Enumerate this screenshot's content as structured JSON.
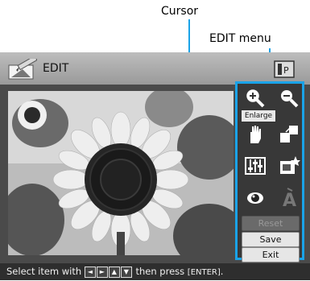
{
  "callouts": {
    "cursor": "Cursor",
    "edit_menu": "EDIT menu"
  },
  "header": {
    "title": "EDIT",
    "edit_icon": "pencil-edit-icon",
    "printer_icon": "print-mode-icon"
  },
  "photo": {
    "subject": "sunflower"
  },
  "menu": {
    "tooltip": "Enlarge",
    "tools": [
      {
        "name": "enlarge-icon"
      },
      {
        "name": "reduce-icon"
      },
      {
        "name": "move-hand-icon"
      },
      {
        "name": "rotate-icon"
      },
      {
        "name": "adjust-icon"
      },
      {
        "name": "filter-icon"
      },
      {
        "name": "red-eye-icon"
      },
      {
        "name": "text-icon"
      }
    ],
    "buttons": {
      "reset": "Reset",
      "save": "Save",
      "exit": "Exit"
    }
  },
  "status": {
    "prefix": "Select item with",
    "arrows": [
      "◄",
      "►",
      "▲",
      "▼"
    ],
    "middle": "then press",
    "enter_key": "[ENTER]",
    "suffix": "."
  },
  "colors": {
    "highlight": "#1aa3e8"
  }
}
